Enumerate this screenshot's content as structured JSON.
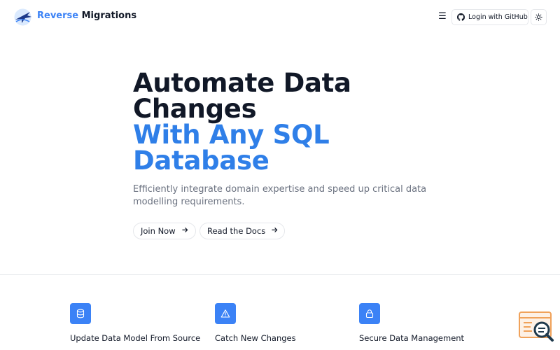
{
  "header": {
    "brand_part1": "Reverse",
    "brand_part2": "Migrations",
    "login_label": "Login with GitHub"
  },
  "hero": {
    "title_line1": "Automate Data",
    "title_line2": "Changes",
    "title_line3": "With Any SQL",
    "title_line4": "Database",
    "subtitle": "Efficiently integrate domain expertise and speed up critical data modelling requirements.",
    "join_label": "Join Now",
    "docs_label": "Read the Docs"
  },
  "features": [
    {
      "title": "Update Data Model From Source",
      "icon": "database-icon"
    },
    {
      "title": "Catch New Changes",
      "icon": "warning-icon"
    },
    {
      "title": "Secure Data Management",
      "icon": "lock-icon"
    }
  ],
  "colors": {
    "accent": "#3b82f6",
    "title_blue": "#2f7fe8",
    "text_dark": "#111827",
    "text_muted": "#6b7280",
    "border": "#e5e7eb",
    "floating_orange": "#f0a25a"
  }
}
